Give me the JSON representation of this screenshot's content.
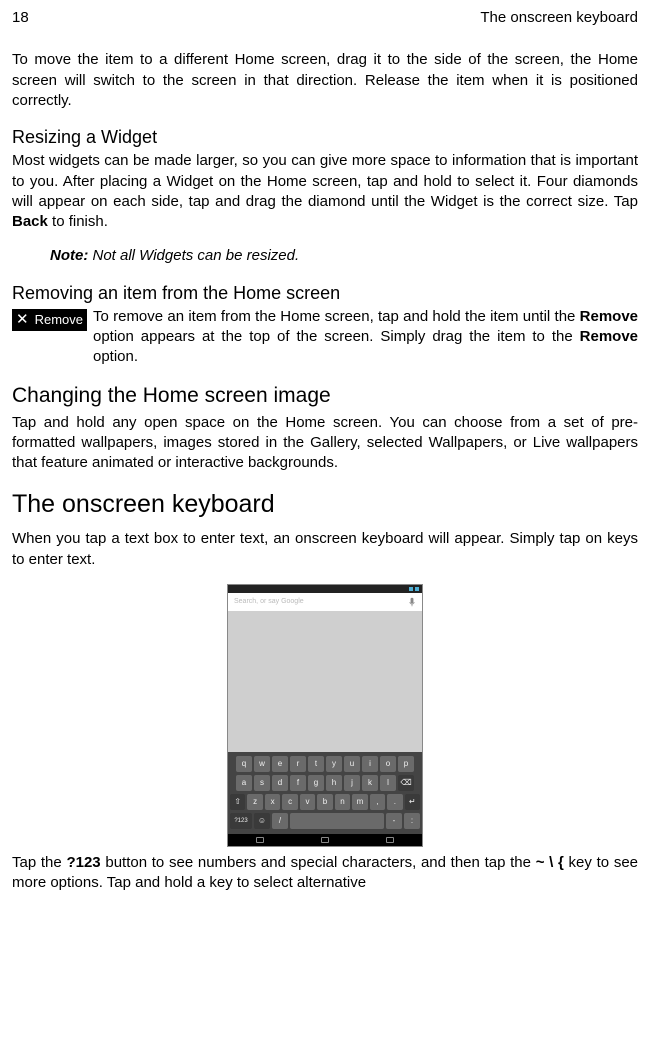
{
  "header": {
    "page": "18",
    "title": "The onscreen keyboard"
  },
  "para_move": "To move the item to a different Home screen, drag it to the side of the screen, the Home screen will switch to the screen in that direction. Release the item when it is positioned correctly.",
  "resizing": {
    "heading": "Resizing a Widget",
    "text_a": "Most widgets can be made larger, so you can give more space to information that is important to you. After placing a Widget on the Home screen, tap and hold to select it. Four diamonds will appear on each side, tap and drag the diamond until the Widget is the correct size. Tap ",
    "bold1": "Back",
    "text_b": " to finish.",
    "note_label": "Note:",
    "note_text": " Not all Widgets can be resized."
  },
  "removing": {
    "heading": "Removing an item from the Home screen",
    "chip": "Remove",
    "text_a": "To remove an item from the Home screen, tap and hold the item until the ",
    "bold1": "Remove",
    "text_b": " option appears at the top of the screen. Simply drag the item to the ",
    "bold2": "Remove",
    "text_c": " option."
  },
  "changing": {
    "heading": "Changing the Home screen image",
    "text": "Tap and hold any open space on the Home screen. You can choose from a set of pre-formatted wallpapers, images stored in the Gallery, selected Wallpapers, or Live wallpapers that feature animated or interactive backgrounds."
  },
  "kb_section": {
    "heading": "The onscreen keyboard",
    "intro": "When you tap a text box to enter text, an onscreen keyboard will appear. Simply tap on keys to enter text.",
    "search_placeholder": "Search, or say Google",
    "row1": [
      "q",
      "w",
      "e",
      "r",
      "t",
      "y",
      "u",
      "i",
      "o",
      "p"
    ],
    "row2": [
      "a",
      "s",
      "d",
      "f",
      "g",
      "h",
      "j",
      "k",
      "l"
    ],
    "row3": [
      "z",
      "x",
      "c",
      "v",
      "b",
      "n",
      "m",
      ",",
      "."
    ],
    "row4_left": "?123",
    "row4_slash": "/",
    "row4_dash": "-",
    "row4_colon": ":",
    "tail_a": "Tap the ",
    "bold1": "?123",
    "tail_b": " button to see numbers and special characters, and then tap the ",
    "bold2": "~ \\ {",
    "tail_c": " key to see more options. Tap and hold a key to select alternative"
  }
}
